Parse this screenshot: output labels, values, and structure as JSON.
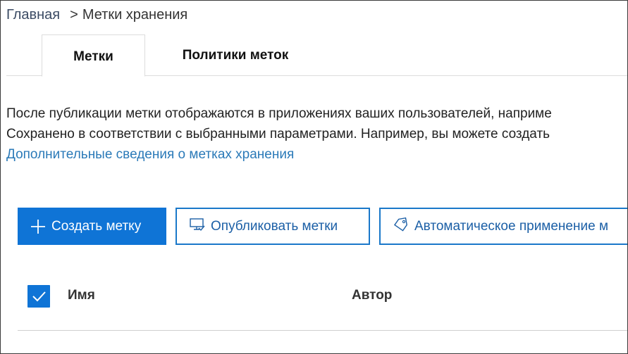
{
  "breadcrumb": {
    "home": "Главная",
    "separator": ">",
    "current": "Метки хранения"
  },
  "tabs": [
    {
      "label": "Метки",
      "active": true
    },
    {
      "label": "Политики меток",
      "active": false
    }
  ],
  "description": {
    "line1": "После публикации метки отображаются в приложениях ваших пользователей, наприме",
    "line2": "Сохранено в соответствии с выбранными параметрами. Например, вы можете создать",
    "link": "Дополнительные сведения о метках хранения"
  },
  "toolbar": {
    "create_label": "Создать метку",
    "create_icon": "plus-icon",
    "publish_label": "Опубликовать метки",
    "publish_icon": "publish-icon",
    "auto_label": "Автоматическое применение м",
    "auto_icon": "tag-icon"
  },
  "table": {
    "select_all_checked": true,
    "columns": [
      "Имя",
      "Автор"
    ]
  },
  "colors": {
    "accent": "#0f74d6",
    "link": "#2b7ab8"
  }
}
